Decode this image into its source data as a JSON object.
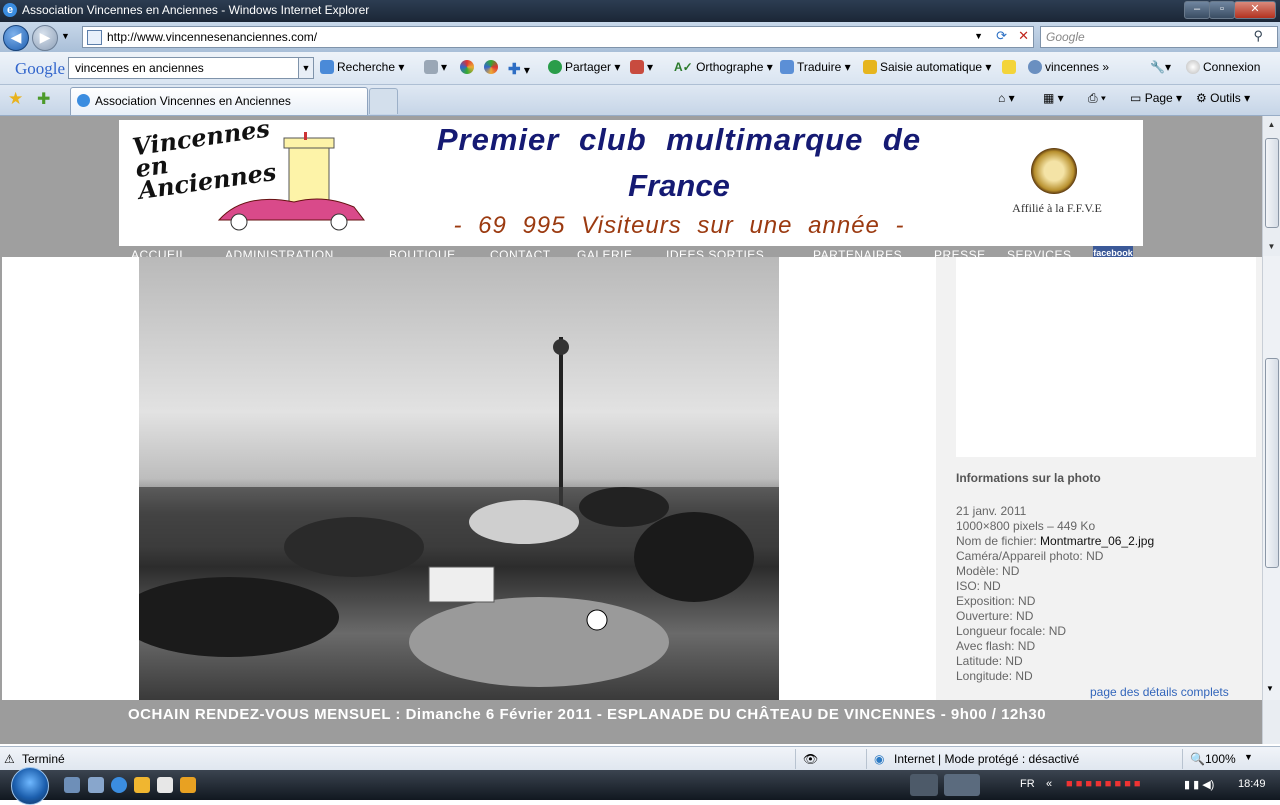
{
  "window": {
    "title": "Association Vincennes en Anciennes - Windows Internet Explorer",
    "controls": {
      "minimize": "–",
      "maximize": "▫",
      "close": "✕"
    }
  },
  "address_bar": {
    "url": "http://www.vincennesenanciennes.com/",
    "search_placeholder": "Google"
  },
  "google_toolbar": {
    "logo": "Google",
    "query": "vincennes en anciennes",
    "items": [
      "Recherche",
      "Partager",
      "Orthographe",
      "Traduire",
      "Saisie automatique",
      "vincennes",
      "Connexion"
    ]
  },
  "tabs": {
    "active_title": "Association Vincennes en Anciennes",
    "commands": [
      "Page",
      "Outils"
    ]
  },
  "site": {
    "logo_text": "Vincennes en Anciennes",
    "headline_line1": "Premier club multimarque de",
    "headline_line2": "France",
    "visits": "- 69 995 Visiteurs sur une année -",
    "affiliation": "Affilié à la F.F.V.E",
    "menu": [
      "ACCUEIL",
      "ADMINISTRATION",
      "BOUTIQUE",
      "CONTACT",
      "GALERIE",
      "IDEES SORTIES",
      "PARTENAIRES",
      "PRESSE",
      "SERVICES"
    ],
    "facebook": "facebook"
  },
  "photo_info": {
    "title": "Informations sur la photo",
    "date": "21 janv. 2011",
    "size": "1000×800 pixels – 449 Ko",
    "filename_label": "Nom de fichier:",
    "filename": "Montmartre_06_2.jpg",
    "camera": "Caméra/Appareil photo: ND",
    "model": "Modèle: ND",
    "iso": "ISO: ND",
    "exposure": "Exposition: ND",
    "aperture": "Ouverture: ND",
    "focal": "Longueur focale: ND",
    "flash": "Avec flash: ND",
    "latitude": "Latitude: ND",
    "longitude": "Longitude: ND",
    "details_link": "page des détails complets"
  },
  "ticker": "OCHAIN RENDEZ-VOUS MENSUEL :  Dimanche 6 Février 2011 - ESPLANADE DU CHÂTEAU DE VINCENNES - 9h00 / 12h30",
  "status_bar": {
    "status": "Terminé",
    "zone": "Internet | Mode protégé : désactivé",
    "zoom": "100%"
  },
  "taskbar": {
    "language": "FR",
    "time": "18:49"
  }
}
